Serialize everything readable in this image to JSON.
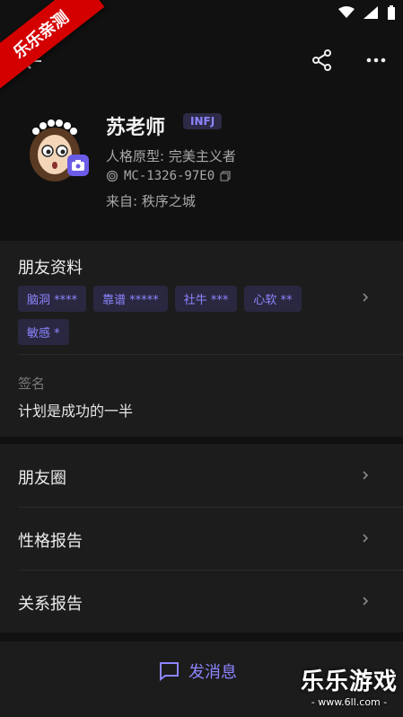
{
  "status_bar": {
    "icons": [
      "wifi-icon",
      "signal-icon",
      "battery-icon"
    ]
  },
  "watermark": {
    "corner_text": "乐乐亲测",
    "brand": "乐乐游戏",
    "url": "- www.6ll.com -"
  },
  "header": {
    "back_icon": "arrow-left-icon",
    "share_icon": "share-icon",
    "more_icon": "more-icon"
  },
  "profile": {
    "name": "苏老师",
    "mbti": "INFJ",
    "archetype": "人格原型: 完美主义者",
    "id": "MC-1326-97E0",
    "origin": "来自: 秩序之城"
  },
  "friends": {
    "title": "朋友资料",
    "tags": [
      "脑洞 ****",
      "靠谱 *****",
      "社牛 ***",
      "心软 **",
      "敏感 *"
    ],
    "sign_label": "签名",
    "sign_text": "计划是成功的一半"
  },
  "menu": {
    "items": [
      {
        "label": "朋友圈"
      },
      {
        "label": "性格报告"
      },
      {
        "label": "关系报告"
      }
    ]
  },
  "bottom": {
    "send_label": "发消息"
  },
  "colors": {
    "accent": "#8c85ff",
    "background": "#111111",
    "card": "#1c1c1c"
  }
}
